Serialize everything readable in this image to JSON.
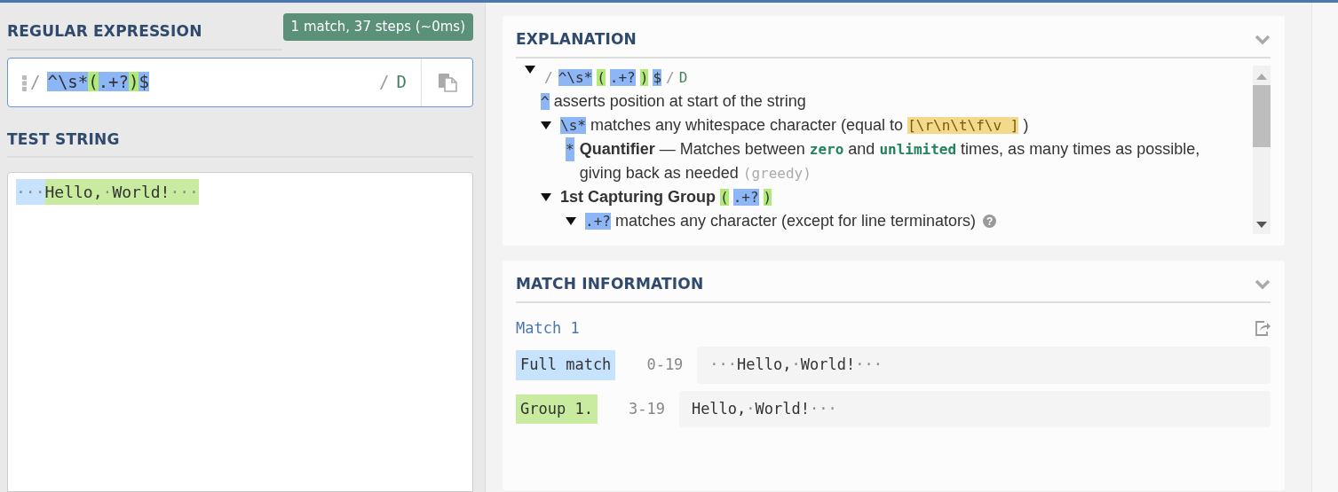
{
  "regex_panel": {
    "title": "REGULAR EXPRESSION",
    "status_badge": "1 match, 37 steps (~0ms)",
    "regex": {
      "delimiter_open": "/",
      "tokens": [
        {
          "kind": "token",
          "text": "^\\s*"
        },
        {
          "kind": "group",
          "text": "("
        },
        {
          "kind": "token",
          "text": ".+?"
        },
        {
          "kind": "group",
          "text": ")"
        },
        {
          "kind": "token",
          "text": "$"
        }
      ],
      "delimiter_close": "/",
      "flags": "D"
    }
  },
  "test_panel": {
    "title": "TEST STRING",
    "segments": [
      {
        "kind": "full-ws",
        "text": "···"
      },
      {
        "kind": "group",
        "text": "Hello,"
      },
      {
        "kind": "group-ws",
        "text": "·"
      },
      {
        "kind": "group",
        "text": "World!"
      },
      {
        "kind": "group-ws",
        "text": "···"
      }
    ]
  },
  "explanation": {
    "title": "EXPLANATION",
    "tree": [
      {
        "kind": "branch",
        "expanded": true,
        "parts": [
          {
            "kind": "slash",
            "text": "/"
          },
          {
            "kind": "token",
            "text": "^\\s*"
          },
          {
            "kind": "group",
            "text": "("
          },
          {
            "kind": "token",
            "text": ".+?"
          },
          {
            "kind": "group",
            "text": ")"
          },
          {
            "kind": "token",
            "text": "$"
          },
          {
            "kind": "slash",
            "text": "/"
          },
          {
            "kind": "flag",
            "text": "D"
          }
        ],
        "children": [
          {
            "kind": "leaf",
            "parts": [
              {
                "kind": "token",
                "text": "^"
              },
              {
                "kind": "text",
                "text": "asserts position at start of the string"
              }
            ]
          },
          {
            "kind": "branch",
            "expanded": true,
            "parts": [
              {
                "kind": "token",
                "text": "\\s*"
              },
              {
                "kind": "text",
                "text": "matches any whitespace character (equal to"
              },
              {
                "kind": "charclass",
                "text": "[\\r\\n\\t\\f\\v ]"
              },
              {
                "kind": "text",
                "text": ")"
              }
            ],
            "children": [
              {
                "kind": "leaf",
                "parts": [
                  {
                    "kind": "token",
                    "text": "*"
                  },
                  {
                    "kind": "bold",
                    "text": "Quantifier"
                  },
                  {
                    "kind": "text",
                    "text": "— Matches between"
                  },
                  {
                    "kind": "code",
                    "text": "zero"
                  },
                  {
                    "kind": "text",
                    "text": "and"
                  },
                  {
                    "kind": "code",
                    "text": "unlimited"
                  },
                  {
                    "kind": "text",
                    "text": "times, as many times as possible, giving back as needed"
                  },
                  {
                    "kind": "muted",
                    "text": "(greedy)"
                  }
                ]
              }
            ]
          },
          {
            "kind": "branch",
            "expanded": true,
            "parts": [
              {
                "kind": "bold",
                "text": "1st Capturing Group"
              },
              {
                "kind": "group",
                "text": "("
              },
              {
                "kind": "token",
                "text": ".+?"
              },
              {
                "kind": "group",
                "text": ")"
              }
            ],
            "children": [
              {
                "kind": "branch",
                "expanded": true,
                "parts": [
                  {
                    "kind": "token",
                    "text": ".+?"
                  },
                  {
                    "kind": "text",
                    "text": "matches any character (except for line terminators)"
                  },
                  {
                    "kind": "help",
                    "text": "?"
                  }
                ]
              }
            ]
          }
        ]
      }
    ]
  },
  "match_information": {
    "title": "MATCH INFORMATION",
    "matches": [
      {
        "title": "Match 1",
        "rows": [
          {
            "kind": "full",
            "label": "Full match",
            "range": "0-19",
            "segments": [
              {
                "kind": "ws",
                "text": "···"
              },
              {
                "kind": "text",
                "text": "Hello,"
              },
              {
                "kind": "ws",
                "text": "·"
              },
              {
                "kind": "text",
                "text": "World!"
              },
              {
                "kind": "ws",
                "text": "···"
              }
            ]
          },
          {
            "kind": "group",
            "label": "Group 1.",
            "range": "3-19",
            "segments": [
              {
                "kind": "text",
                "text": "Hello,"
              },
              {
                "kind": "ws",
                "text": "·"
              },
              {
                "kind": "text",
                "text": "World!"
              },
              {
                "kind": "ws",
                "text": "···"
              }
            ]
          }
        ]
      }
    ]
  }
}
